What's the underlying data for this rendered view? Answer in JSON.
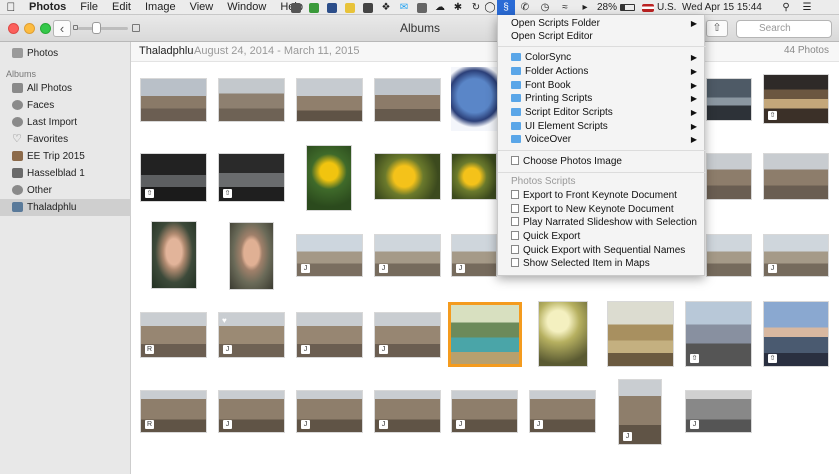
{
  "menubar": {
    "app_name": "Photos",
    "menus": [
      "File",
      "Edit",
      "Image",
      "View",
      "Window",
      "Help"
    ],
    "battery": "28%",
    "input_source": "U.S.",
    "clock": "Wed Apr 15  15:44"
  },
  "toolbar": {
    "title": "Albums",
    "search_placeholder": "Search"
  },
  "sidebar": {
    "top_item": "Photos",
    "section_header": "Albums",
    "items": [
      "All Photos",
      "Faces",
      "Last Import",
      "Favorites",
      "EE Trip 2015",
      "Hasselblad 1",
      "Other",
      "Thaladphlu"
    ]
  },
  "content": {
    "album_name": "Thaladphlu",
    "date_range": "August 24, 2014 - March 11, 2015",
    "count": "44 Photos"
  },
  "script_menu": {
    "open_folder": "Open Scripts Folder",
    "open_editor": "Open Script Editor",
    "folders": [
      "ColorSync",
      "Folder Actions",
      "Font Book",
      "Printing Scripts",
      "Script Editor Scripts",
      "UI Element Scripts",
      "VoiceOver"
    ],
    "choose_image": "Choose Photos Image",
    "section_header": "Photos Scripts",
    "photos_scripts": [
      "Export to Front Keynote Document",
      "Export to New Keynote Document",
      "Play Narrated Slideshow with Selection",
      "Quick Export",
      "Quick Export with Sequential Names",
      "Show Selected Item in Maps"
    ]
  },
  "colors": {
    "selection_border": "#f49b1e",
    "menu_bg": "#f4f4f4",
    "sidebar_bg": "#e8e8e8"
  }
}
